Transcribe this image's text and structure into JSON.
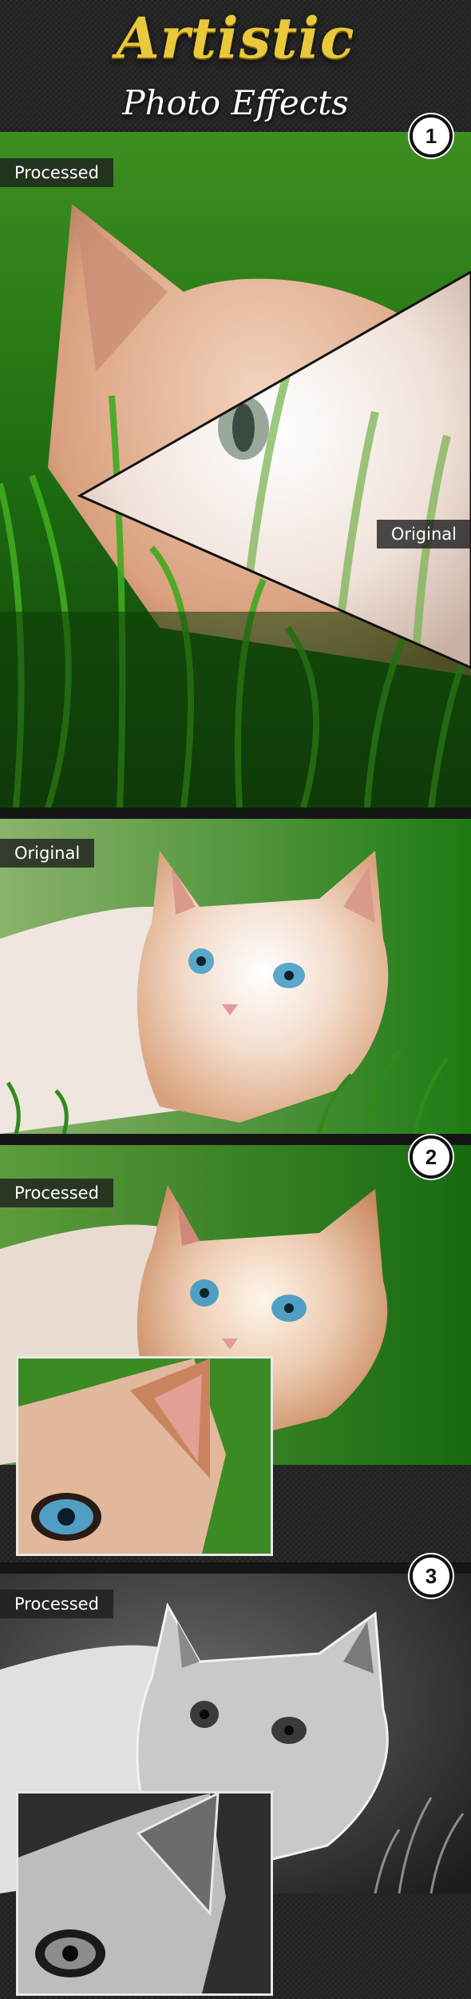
{
  "header": {
    "title": "Artistic",
    "subtitle": "Photo Effects"
  },
  "sections": [
    {
      "number": "1",
      "labels": [
        "Processed",
        "Original"
      ]
    },
    {
      "label": "Original"
    },
    {
      "number": "2",
      "label": "Processed"
    },
    {
      "number": "3",
      "label": "Processed"
    }
  ],
  "colors": {
    "title": "#e8c93a",
    "grass": "#2f8a1e",
    "fur": "#e8b28a",
    "eye": "#4f9fc4"
  }
}
